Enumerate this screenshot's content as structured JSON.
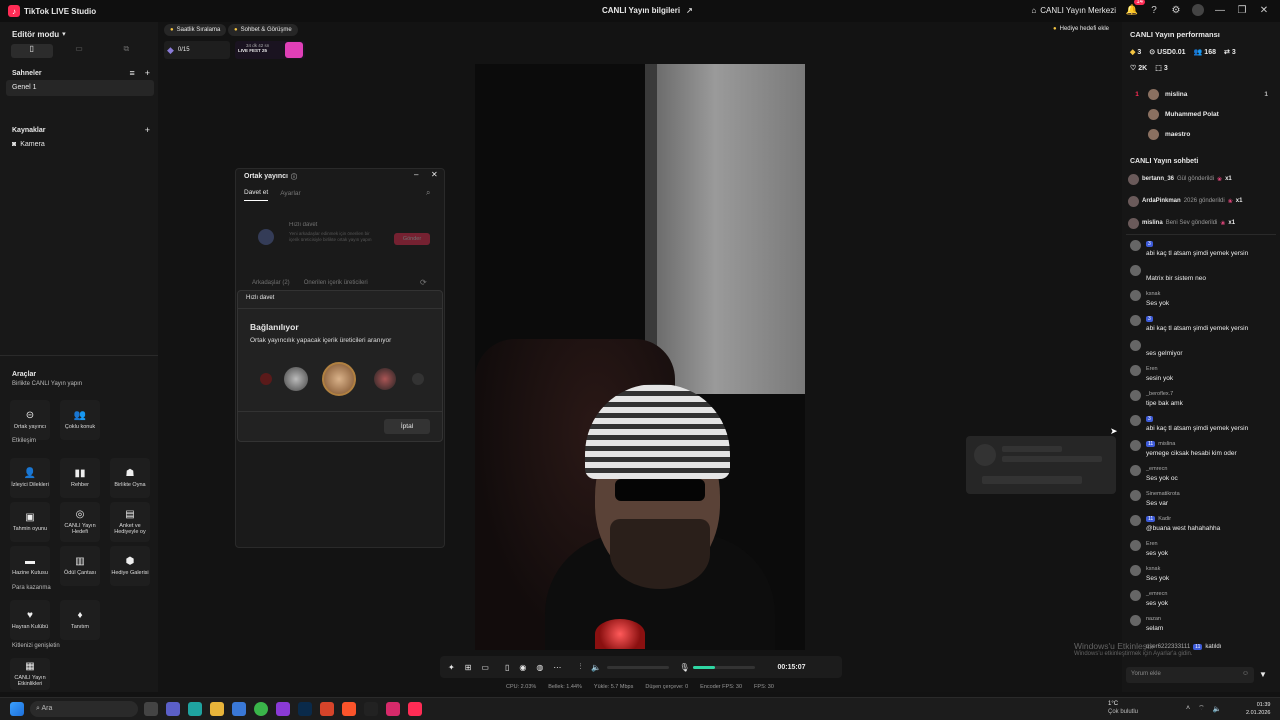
{
  "app": {
    "title": "TikTok LIVE Studio",
    "center_title": "CANLI Yayın bilgileri",
    "center_link": "CANLI Yayın Merkezi",
    "notif_count": "14"
  },
  "left": {
    "editor_mode": "Editör modu",
    "scenes_title": "Sahneler",
    "scene_item": "Genel 1",
    "sources_title": "Kaynaklar",
    "source_item": "Kamera",
    "tools_title": "Araçlar",
    "cat1": "Birlikte CANLI Yayın yapın",
    "cat2": "Etkileşim",
    "cat3": "Para kazanma",
    "cat4": "Kitlenizi genişletin",
    "tools": [
      "Ortak yayıncı",
      "Çoklu konuk",
      "İzleyici Dilekleri",
      "Rehber",
      "Birlikte Oyna",
      "Tahmin oyunu",
      "CANLI Yayın Hedefi",
      "Anket ve Hediyeyle oy",
      "Hazine Kutusu",
      "Ödül Çantası",
      "Hediye Galerisi",
      "Hayran Kulübü",
      "Tanıtım",
      "CANLI Yayın Etkinlikleri"
    ]
  },
  "stage": {
    "chip1": "Saatlik Sıralama",
    "chip2": "Sohbet & Görüşme",
    "progress": "0/15",
    "event_small": "34 dk 42 sn",
    "event_name": "LIVE FEST 25",
    "gift_goal": "Hediye hedefi ekle"
  },
  "dialog": {
    "title": "Ortak yayıncı",
    "tab1": "Davet et",
    "tab2": "Ayarlar",
    "quick_title": "Hızlı davet",
    "quick_desc": "Yeni arkadaşlar edinmek için önerilen bir içerik üreticisiyle birlikte ortak yayın yapın",
    "send": "Gönder",
    "friends": "Arkadaşlar (2)",
    "suggested": "Önerilen içerik üreticileri"
  },
  "popup": {
    "header": "Hızlı davet",
    "title": "Bağlanılıyor",
    "sub": "Ortak yayıncılık yapacak içerik üreticileri aranıyor",
    "cancel": "İptal"
  },
  "controls": {
    "timer": "00:15:07"
  },
  "stats": [
    "CPU: 2.03%",
    "Bellek: 1.44%",
    "Yükle: 5.7 Mbps",
    "Düşen çerçeve: 0",
    "Encoder FPS: 30",
    "FPS: 30"
  ],
  "perf": {
    "title": "CANLI Yayın performansı",
    "diamonds": "3",
    "usd": "USD0.01",
    "viewers": "168",
    "shares": "3",
    "likes": "2K",
    "gifts": "3",
    "rank": [
      {
        "pos": "1",
        "name": "mislina",
        "val": "1"
      },
      {
        "pos": "",
        "name": "Muhammed Polat",
        "val": ""
      },
      {
        "pos": "",
        "name": "maestro",
        "val": ""
      }
    ]
  },
  "chat": {
    "title": "CANLI Yayın sohbeti",
    "gifts": [
      {
        "user": "bertann_36",
        "text": "Gül gönderildi",
        "x": "x1"
      },
      {
        "user": "ArdaPinkman",
        "text": "2026 gönderildi",
        "x": "x1"
      },
      {
        "user": "mislina",
        "text": "Beni Sev gönderildi",
        "x": "x1"
      }
    ],
    "messages": [
      {
        "user": "",
        "lvl": "3",
        "msg": "abi kaç tl atsam şimdi yemek yersin"
      },
      {
        "user": "",
        "lvl": "",
        "msg": "Matrix bir sistem neo"
      },
      {
        "user": "ksnak",
        "lvl": "",
        "msg": "Ses yok"
      },
      {
        "user": "",
        "lvl": "3",
        "msg": "abi kaç tl atsam şimdi yemek yersin"
      },
      {
        "user": "",
        "lvl": "",
        "msg": "ses gelmiyor"
      },
      {
        "user": "Eren",
        "lvl": "",
        "msg": "sesin yok"
      },
      {
        "user": "_beroflex.7",
        "lvl": "",
        "msg": "tipe bak amk"
      },
      {
        "user": "",
        "lvl": "3",
        "msg": "abi kaç tl atsam şimdi yemek yersin"
      },
      {
        "user": "mislina",
        "lvl": "11",
        "msg": "yemege ciksak hesabi kim oder"
      },
      {
        "user": "_emrecn",
        "lvl": "",
        "msg": "Ses yok oc"
      },
      {
        "user": "Sinematikrota",
        "lvl": "",
        "msg": "Ses var"
      },
      {
        "user": "Kadir",
        "lvl": "11",
        "msg": "@buana west hahahahha"
      },
      {
        "user": "Eren",
        "lvl": "",
        "msg": "ses yok"
      },
      {
        "user": "ksnak",
        "lvl": "",
        "msg": "Ses yok"
      },
      {
        "user": "_emrecn",
        "lvl": "",
        "msg": "ses yok"
      },
      {
        "user": "nazan",
        "lvl": "",
        "msg": "selam"
      }
    ],
    "join_user": "user6222333111",
    "join_text": "katıldı",
    "input_placeholder": "Yorum ekle"
  },
  "watermark": {
    "line1": "Windows'u Etkinleştir",
    "line2": "Windows'u etkinleştirmek için Ayarlar'a gidin."
  },
  "taskbar": {
    "search": "Ara",
    "weather_temp": "1°C",
    "weather_desc": "Çok bulutlu",
    "time": "01:39",
    "date": "2.01.2026"
  }
}
